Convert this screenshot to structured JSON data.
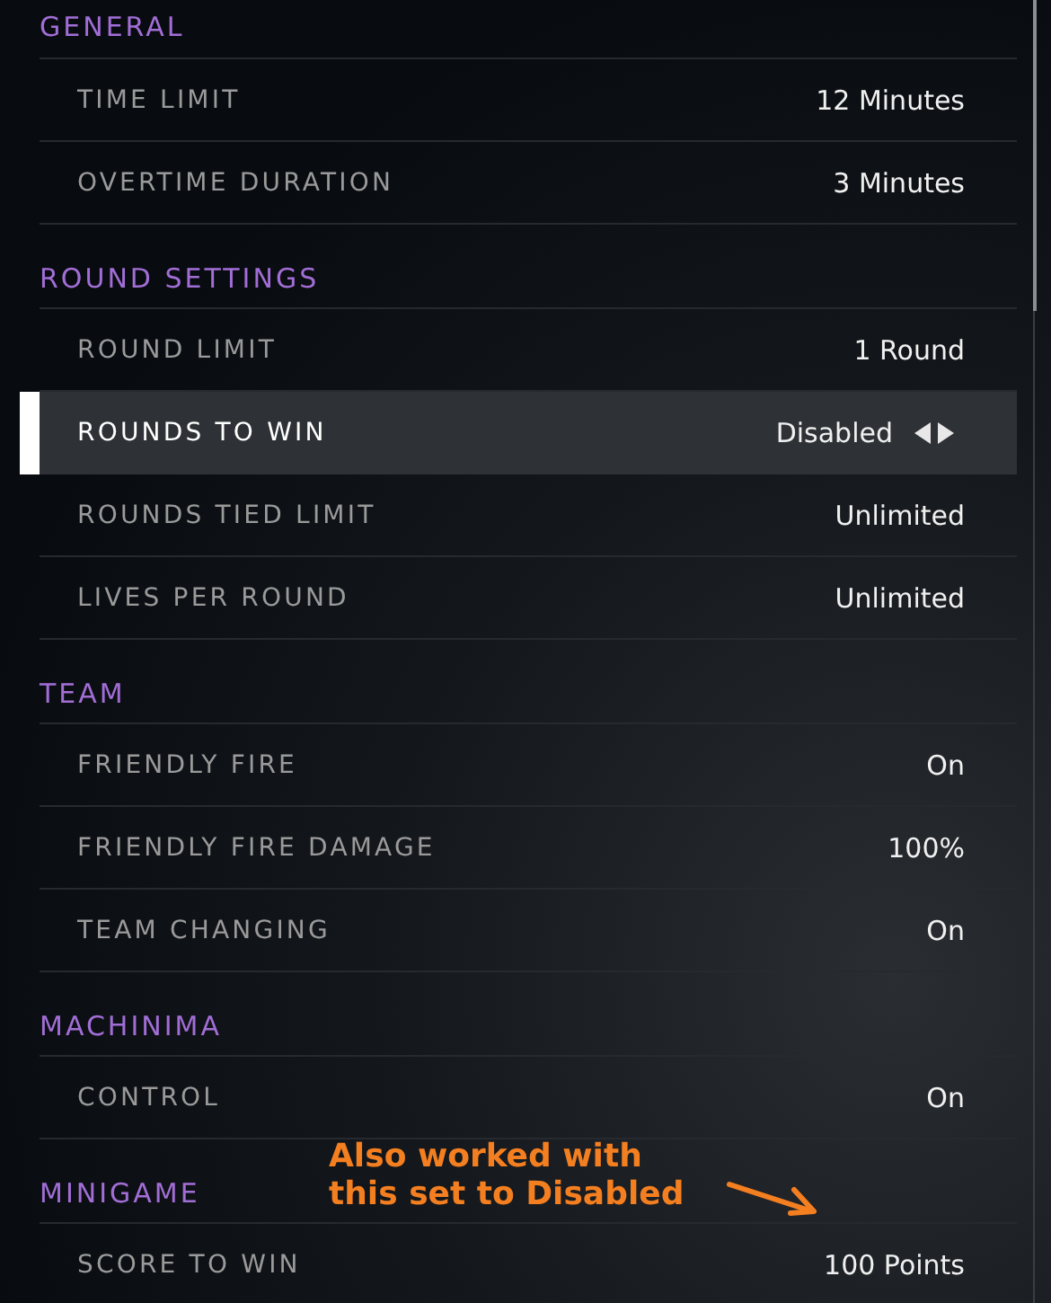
{
  "sections": [
    {
      "title": "GENERAL",
      "rows": [
        {
          "label": "TIME LIMIT",
          "value": "12 Minutes",
          "selected": false
        },
        {
          "label": "OVERTIME DURATION",
          "value": "3 Minutes",
          "selected": false
        }
      ]
    },
    {
      "title": "ROUND SETTINGS",
      "rows": [
        {
          "label": "ROUND LIMIT",
          "value": "1 Round",
          "selected": false
        },
        {
          "label": "ROUNDS TO WIN",
          "value": "Disabled",
          "selected": true
        },
        {
          "label": "ROUNDS TIED LIMIT",
          "value": "Unlimited",
          "selected": false
        },
        {
          "label": "LIVES PER ROUND",
          "value": "Unlimited",
          "selected": false
        }
      ]
    },
    {
      "title": "TEAM",
      "rows": [
        {
          "label": "FRIENDLY FIRE",
          "value": "On",
          "selected": false
        },
        {
          "label": "FRIENDLY FIRE DAMAGE",
          "value": "100%",
          "selected": false
        },
        {
          "label": "TEAM CHANGING",
          "value": "On",
          "selected": false
        }
      ]
    },
    {
      "title": "MACHINIMA",
      "rows": [
        {
          "label": "CONTROL",
          "value": "On",
          "selected": false
        }
      ]
    },
    {
      "title": "MINIGAME",
      "rows": [
        {
          "label": "SCORE TO WIN",
          "value": "100 Points",
          "selected": false
        }
      ]
    }
  ],
  "annotation": {
    "lines": [
      "Also worked with",
      "this set to Disabled"
    ]
  }
}
